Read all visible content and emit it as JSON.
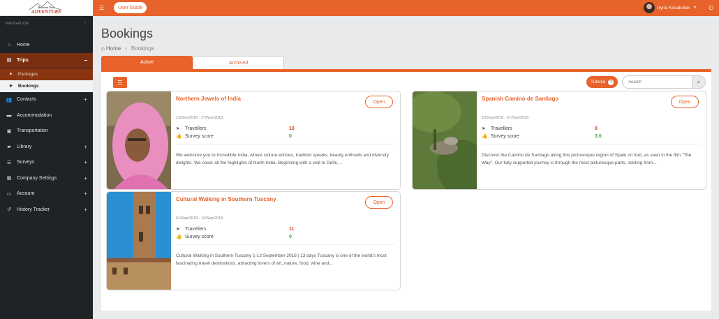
{
  "app": {
    "logo_line1": "Between Your",
    "logo_line2": "ADVENTURE"
  },
  "topbar": {
    "user_guide_label": "User Guide",
    "user_name": "Iryna Kovalchuk"
  },
  "sidebar": {
    "header": "NAVIGATION",
    "items": [
      {
        "label": "Home",
        "icon": "home-icon"
      },
      {
        "label": "Trips",
        "icon": "trips-icon",
        "toggle": "−"
      },
      {
        "label": "Packages"
      },
      {
        "label": "Bookings"
      },
      {
        "label": "Contacts",
        "icon": "contacts-icon",
        "toggle": "+"
      },
      {
        "label": "Accommodation",
        "icon": "bed-icon"
      },
      {
        "label": "Transportation",
        "icon": "bus-icon"
      },
      {
        "label": "Library",
        "icon": "folder-icon",
        "toggle": "+"
      },
      {
        "label": "Surveys",
        "icon": "survey-icon",
        "toggle": "+"
      },
      {
        "label": "Company Settings",
        "icon": "settings-icon",
        "toggle": "+"
      },
      {
        "label": "Account",
        "icon": "account-icon",
        "toggle": "+"
      },
      {
        "label": "History Tracker",
        "icon": "history-icon",
        "toggle": "+"
      }
    ]
  },
  "page": {
    "title": "Bookings",
    "breadcrumb_home": "Home",
    "breadcrumb_current": "Bookings"
  },
  "tabs": {
    "active": "Active",
    "archived": "Archived"
  },
  "toolbar": {
    "tutorial_label": "Tutorial",
    "tutorial_badge": "?",
    "search_placeholder": "Search"
  },
  "labels": {
    "travellers": "Travellers",
    "survey_score": "Survey score",
    "open": "Open"
  },
  "cards": [
    {
      "title": "Northern Jewels of India",
      "dates": "13/Nov/2018 - 27/Nov/2018",
      "travellers": "10",
      "survey_score": "0",
      "description": "We welcome you to Incredible India, where culture echoes, tradition speaks, beauty enthralls and diversity delights. We cover all the highlights of North India. Beginning with a visit to Delhi,..."
    },
    {
      "title": "Spanish Camino de Santiago",
      "dates": "16/Sep/2018 - 27/Sep/2018",
      "travellers": "8",
      "survey_score": "3.0",
      "description": "Discover the Camino de Santiago along this picturesque region of Spain on foot, as seen in the film \"The Way\". Our fully supported journey is through the most picturesque parts, starting from..."
    },
    {
      "title": "Cultural Walking in Southern Tuscany",
      "dates": "01/Sep/2018 - 13/Sep/2018",
      "travellers": "11",
      "survey_score": "0",
      "description": "Cultural Walking in Southern Tuscany 1-13 September 2018 | 13 days Tuscany  is one of the world's most fascinating travel destinations, attracting lovers of art, nature, food, wine and..."
    }
  ],
  "colors": {
    "accent": "#e8632b",
    "sidebar_bg": "#1f2326",
    "active_nav": "#7a2f10"
  }
}
